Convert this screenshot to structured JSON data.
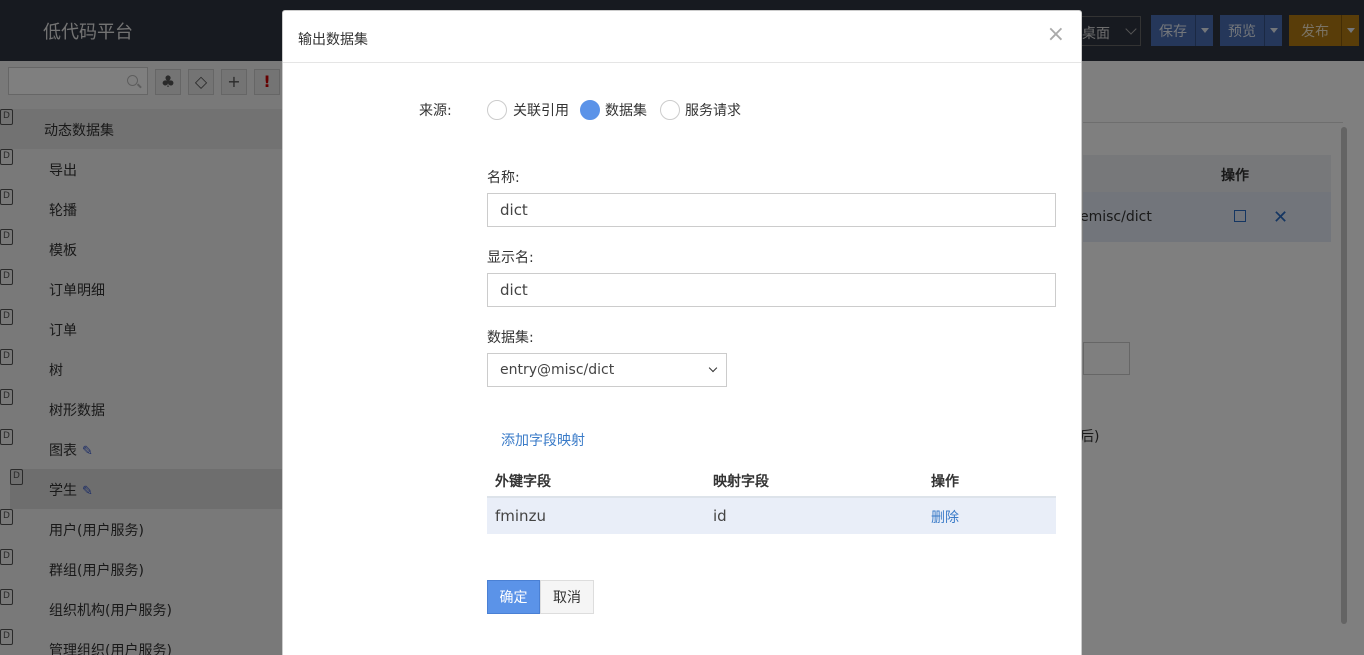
{
  "header": {
    "brand": "低代码平台",
    "select_value": "桌面",
    "save_label": "保存",
    "preview_label": "预览",
    "publish_label": "发布"
  },
  "sidebar": {
    "search_placeholder": "",
    "root_label": "动态数据集",
    "items": [
      {
        "label": "导出"
      },
      {
        "label": "轮播"
      },
      {
        "label": "模板"
      },
      {
        "label": "订单明细"
      },
      {
        "label": "订单"
      },
      {
        "label": "树"
      },
      {
        "label": "树形数据"
      },
      {
        "label": "图表"
      },
      {
        "label": "学生"
      },
      {
        "label": "用户(用户服务)"
      },
      {
        "label": "群组(用户服务)"
      },
      {
        "label": "组织机构(用户服务)"
      },
      {
        "label": "管理组织(用户服务)"
      }
    ]
  },
  "background": {
    "op_header": "操作",
    "row_text": "emisc/dict",
    "paren_text": "后)"
  },
  "modal": {
    "title": "输出数据集",
    "close": "×",
    "source_label": "来源:",
    "sources": [
      "关联引用",
      "数据集",
      "服务请求"
    ],
    "selected_source": "数据集",
    "name_label": "名称:",
    "name_value": "dict",
    "display_label": "显示名:",
    "display_value": "dict",
    "dataset_label": "数据集:",
    "dataset_value": "entry@misc/dict",
    "add_mapping": "添加字段映射",
    "table": {
      "headers": [
        "外键字段",
        "映射字段",
        "操作"
      ],
      "rows": [
        {
          "fk": "fminzu",
          "mapped": "id",
          "action": "删除"
        }
      ]
    },
    "ok_label": "确定",
    "cancel_label": "取消"
  }
}
